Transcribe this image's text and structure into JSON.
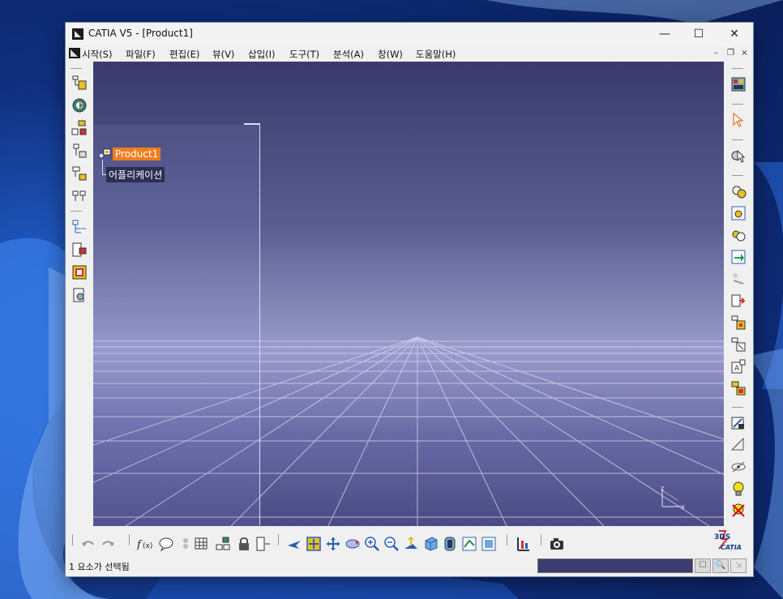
{
  "window": {
    "title": "CATIA V5 - [Product1]",
    "minimize": "—",
    "maximize": "☐",
    "close": "✕"
  },
  "menu": {
    "items": [
      "시작(S)",
      "파일(F)",
      "편집(E)",
      "뷰(V)",
      "삽입(I)",
      "도구(T)",
      "분석(A)",
      "창(W)",
      "도움말(H)"
    ],
    "mdi_minimize": "–",
    "mdi_restore": "❐",
    "mdi_close": "×"
  },
  "tree": {
    "root": "Product1",
    "child": "어플리케이션"
  },
  "axis": {
    "x": "x",
    "z": "z"
  },
  "brand": {
    "logo_text": "CATIA",
    "logo_mark": "3DS"
  },
  "status": {
    "message": "1 요소가 선택됨"
  },
  "colors": {
    "selected_node": "#f07d1e",
    "viewport_top": "#3a3b6c",
    "viewport_horizon": "#9b9ccd"
  }
}
